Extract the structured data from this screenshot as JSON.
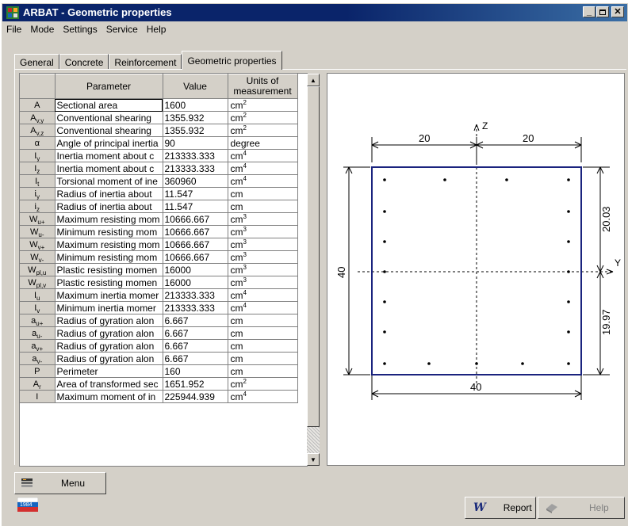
{
  "window": {
    "title": "ARBAT - Geometric properties"
  },
  "menu": [
    "File",
    "Mode",
    "Settings",
    "Service",
    "Help"
  ],
  "tabs": [
    {
      "label": "General"
    },
    {
      "label": "Concrete"
    },
    {
      "label": "Reinforcement"
    },
    {
      "label": "Geometric properties",
      "active": true
    }
  ],
  "grid": {
    "headers": {
      "param": "Parameter",
      "value": "Value",
      "units": "Units of measurement"
    },
    "rows": [
      {
        "sym": "A",
        "sym_sub": "",
        "param": "Sectional area",
        "value": "1600",
        "unit": "cm",
        "unit_sup": "2"
      },
      {
        "sym": "A",
        "sym_sub": "v,y",
        "param": "Conventional shearing",
        "value": "1355.932",
        "unit": "cm",
        "unit_sup": "2"
      },
      {
        "sym": "A",
        "sym_sub": "v,z",
        "param": "Conventional shearing",
        "value": "1355.932",
        "unit": "cm",
        "unit_sup": "2"
      },
      {
        "sym": "α",
        "sym_sub": "",
        "param": "Angle of principal inertia",
        "value": "90",
        "unit": "degree",
        "unit_sup": ""
      },
      {
        "sym": "I",
        "sym_sub": "y",
        "param": "Inertia moment about c",
        "value": "213333.333",
        "unit": "cm",
        "unit_sup": "4"
      },
      {
        "sym": "I",
        "sym_sub": "z",
        "param": "Inertia moment about c",
        "value": "213333.333",
        "unit": "cm",
        "unit_sup": "4"
      },
      {
        "sym": "I",
        "sym_sub": "t",
        "param": "Torsional moment of ine",
        "value": "360960",
        "unit": "cm",
        "unit_sup": "4"
      },
      {
        "sym": "i",
        "sym_sub": "y",
        "param": "Radius of inertia about",
        "value": "11.547",
        "unit": "cm",
        "unit_sup": ""
      },
      {
        "sym": "i",
        "sym_sub": "z",
        "param": "Radius of inertia about",
        "value": "11.547",
        "unit": "cm",
        "unit_sup": ""
      },
      {
        "sym": "W",
        "sym_sub": "u+",
        "param": "Maximum resisting mom",
        "value": "10666.667",
        "unit": "cm",
        "unit_sup": "3"
      },
      {
        "sym": "W",
        "sym_sub": "u-",
        "param": "Minimum resisting mom",
        "value": "10666.667",
        "unit": "cm",
        "unit_sup": "3"
      },
      {
        "sym": "W",
        "sym_sub": "v+",
        "param": "Maximum resisting mom",
        "value": "10666.667",
        "unit": "cm",
        "unit_sup": "3"
      },
      {
        "sym": "W",
        "sym_sub": "v-",
        "param": "Minimum resisting mom",
        "value": "10666.667",
        "unit": "cm",
        "unit_sup": "3"
      },
      {
        "sym": "W",
        "sym_sub": "pl,u",
        "param": "Plastic resisting momen",
        "value": "16000",
        "unit": "cm",
        "unit_sup": "3"
      },
      {
        "sym": "W",
        "sym_sub": "pl,v",
        "param": "Plastic resisting momen",
        "value": "16000",
        "unit": "cm",
        "unit_sup": "3"
      },
      {
        "sym": "I",
        "sym_sub": "u",
        "param": "Maximum inertia momer",
        "value": "213333.333",
        "unit": "cm",
        "unit_sup": "4"
      },
      {
        "sym": "I",
        "sym_sub": "v",
        "param": "Minimum inertia momer",
        "value": "213333.333",
        "unit": "cm",
        "unit_sup": "4"
      },
      {
        "sym": "a",
        "sym_sub": "u+",
        "param": "Radius of gyration alon",
        "value": "6.667",
        "unit": "cm",
        "unit_sup": ""
      },
      {
        "sym": "a",
        "sym_sub": "u-",
        "param": "Radius of gyration alon",
        "value": "6.667",
        "unit": "cm",
        "unit_sup": ""
      },
      {
        "sym": "a",
        "sym_sub": "v+",
        "param": "Radius of gyration alon",
        "value": "6.667",
        "unit": "cm",
        "unit_sup": ""
      },
      {
        "sym": "a",
        "sym_sub": "v-",
        "param": "Radius of gyration alon",
        "value": "6.667",
        "unit": "cm",
        "unit_sup": ""
      },
      {
        "sym": "P",
        "sym_sub": "",
        "param": "Perimeter",
        "value": "160",
        "unit": "cm",
        "unit_sup": ""
      },
      {
        "sym": "A",
        "sym_sub": "r",
        "param": "Area of transformed sec",
        "value": "1651.952",
        "unit": "cm",
        "unit_sup": "2"
      },
      {
        "sym": "I",
        "sym_sub": "",
        "param": "Maximum moment of in",
        "value": "225944.939",
        "unit": "cm",
        "unit_sup": "4"
      }
    ]
  },
  "drawing": {
    "axis_y": "Y",
    "axis_z": "Z",
    "dim_top_left": "20",
    "dim_top_right": "20",
    "dim_bottom": "40",
    "dim_left": "40",
    "dim_right_top": "20.03",
    "dim_right_bottom": "19.97",
    "section_color": "#1a237e"
  },
  "bottom": {
    "menu_label": "Menu",
    "report_label": "Report",
    "help_label": "Help",
    "flag_text": "1984"
  }
}
